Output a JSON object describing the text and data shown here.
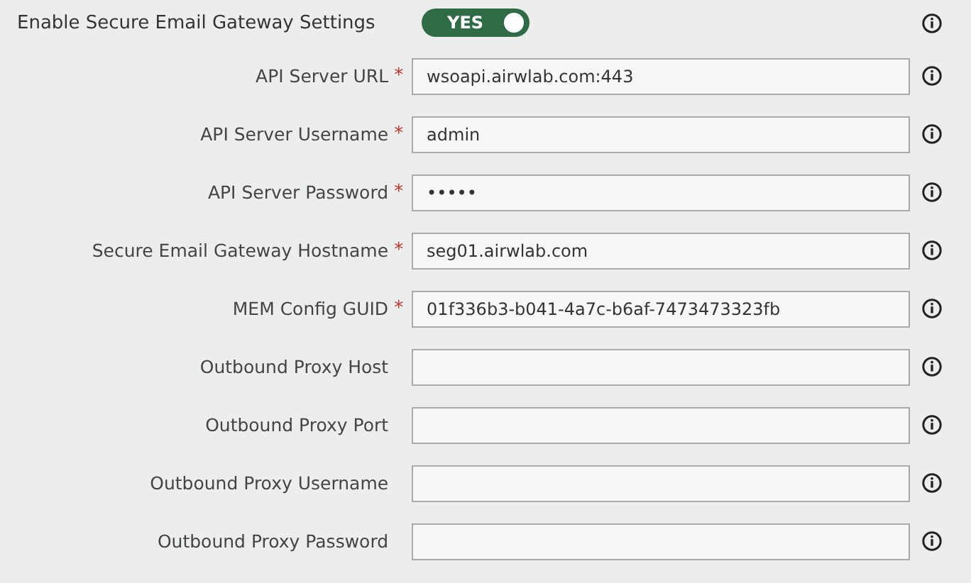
{
  "toggle_row": {
    "label": "Enable Secure Email Gateway Settings",
    "on": true,
    "text": "YES"
  },
  "fields": [
    {
      "label": "API Server URL",
      "required_mark": "*",
      "value": "wsoapi.airwlab.com:443"
    },
    {
      "label": "API Server Username",
      "required_mark": "*",
      "value": "admin"
    },
    {
      "label": "API Server Password",
      "required_mark": "*",
      "value": "•••••"
    },
    {
      "label": "Secure Email Gateway Hostname",
      "required_mark": "*",
      "value": "seg01.airwlab.com"
    },
    {
      "label": "MEM Config GUID",
      "required_mark": "*",
      "value": "01f336b3-b041-4a7c-b6af-7473473323fb"
    },
    {
      "label": "Outbound Proxy Host"
    },
    {
      "label": "Outbound Proxy Port"
    },
    {
      "label": "Outbound Proxy Username"
    },
    {
      "label": "Outbound Proxy Password"
    }
  ]
}
